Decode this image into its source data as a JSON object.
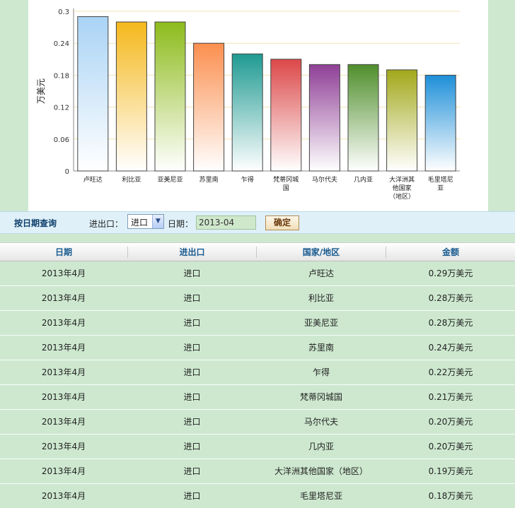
{
  "chart_data": {
    "type": "bar",
    "ylabel": "万美元",
    "ylim": [
      0,
      0.3
    ],
    "yticks": [
      "0",
      "0.06",
      "0.12",
      "0.18",
      "0.24",
      "0.3"
    ],
    "ytick_values": [
      0,
      0.06,
      0.12,
      0.18,
      0.24,
      0.3
    ],
    "categories": [
      "卢旺达",
      "利比亚",
      "亚美尼亚",
      "苏里南",
      "乍得",
      "梵蒂冈城国",
      "马尔代夫",
      "几内亚",
      "大洋洲其他国家（地区）",
      "毛里塔尼亚"
    ],
    "category_lines": [
      [
        "卢旺达"
      ],
      [
        "利比亚"
      ],
      [
        "亚美尼亚"
      ],
      [
        "苏里南"
      ],
      [
        "乍得"
      ],
      [
        "梵蒂冈城",
        "国"
      ],
      [
        "马尔代夫"
      ],
      [
        "几内亚"
      ],
      [
        "大洋洲其",
        "他国家",
        "（地区）"
      ],
      [
        "毛里塔尼",
        "亚"
      ]
    ],
    "values": [
      0.29,
      0.28,
      0.28,
      0.24,
      0.22,
      0.21,
      0.2,
      0.2,
      0.19,
      0.18
    ],
    "colors": [
      "#a9d3f5",
      "#f5b81c",
      "#8dbb1b",
      "#fb8f4f",
      "#1e9a92",
      "#dc4848",
      "#8f3f96",
      "#4f8e2b",
      "#a2a81a",
      "#1e8fd8"
    ],
    "grid": true,
    "gridline_color": "#f2e3b3"
  },
  "filter": {
    "title": "按日期查询",
    "port_label": "进出口：",
    "port_value": "进口",
    "date_label": "日期：",
    "date_value": "2013-04",
    "confirm_label": "确定"
  },
  "table": {
    "headers": [
      "日期",
      "进出口",
      "国家/地区",
      "金额"
    ],
    "rows": [
      [
        "2013年4月",
        "进口",
        "卢旺达",
        "0.29万美元"
      ],
      [
        "2013年4月",
        "进口",
        "利比亚",
        "0.28万美元"
      ],
      [
        "2013年4月",
        "进口",
        "亚美尼亚",
        "0.28万美元"
      ],
      [
        "2013年4月",
        "进口",
        "苏里南",
        "0.24万美元"
      ],
      [
        "2013年4月",
        "进口",
        "乍得",
        "0.22万美元"
      ],
      [
        "2013年4月",
        "进口",
        "梵蒂冈城国",
        "0.21万美元"
      ],
      [
        "2013年4月",
        "进口",
        "马尔代夫",
        "0.20万美元"
      ],
      [
        "2013年4月",
        "进口",
        "几内亚",
        "0.20万美元"
      ],
      [
        "2013年4月",
        "进口",
        "大洋洲其他国家（地区）",
        "0.19万美元"
      ],
      [
        "2013年4月",
        "进口",
        "毛里塔尼亚",
        "0.18万美元"
      ]
    ]
  }
}
